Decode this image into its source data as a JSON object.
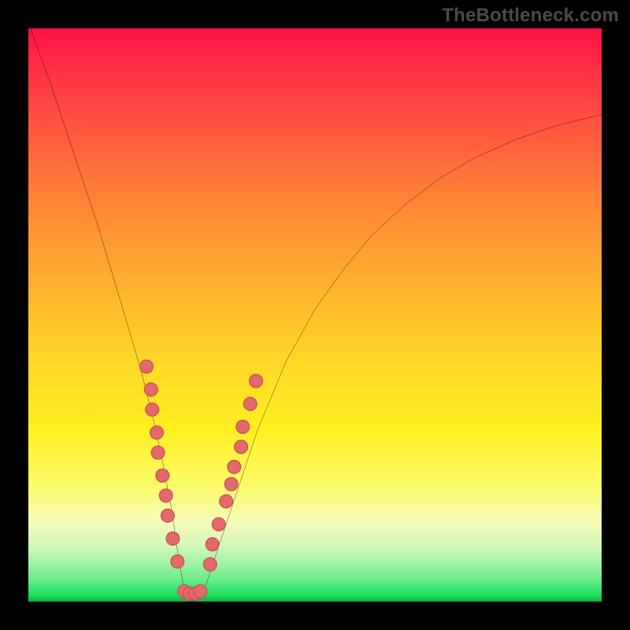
{
  "watermark": "TheBottleneck.com",
  "colors": {
    "frame": "#000000",
    "curve_stroke": "#000000",
    "marker_fill": "#e06a6c",
    "marker_stroke": "#d14e52",
    "gradient_top": "#ff1047",
    "gradient_bottom": "#11a83d"
  },
  "chart_data": {
    "type": "line",
    "title": "",
    "xlabel": "",
    "ylabel": "",
    "xlim": [
      0,
      100
    ],
    "ylim": [
      0,
      100
    ],
    "grid": false,
    "curve": {
      "x": [
        0,
        4,
        8,
        12,
        15,
        18,
        20,
        22,
        23.5,
        25,
        26,
        27,
        28,
        29,
        31,
        33,
        36,
        40,
        45,
        50,
        55,
        60,
        66,
        72,
        78,
        85,
        92,
        100
      ],
      "y": [
        101,
        90,
        78,
        66,
        56,
        46,
        39,
        31,
        24,
        16,
        9,
        3,
        0,
        0,
        3,
        9,
        18,
        30,
        42,
        51,
        58,
        64,
        69.5,
        74,
        77.5,
        80.6,
        83,
        85
      ]
    },
    "markers": [
      {
        "x": 20.6,
        "y": 41
      },
      {
        "x": 21.4,
        "y": 37
      },
      {
        "x": 21.6,
        "y": 33.5
      },
      {
        "x": 22.4,
        "y": 29.5
      },
      {
        "x": 22.6,
        "y": 26
      },
      {
        "x": 23.4,
        "y": 22
      },
      {
        "x": 24.0,
        "y": 18.5
      },
      {
        "x": 24.3,
        "y": 15
      },
      {
        "x": 25.2,
        "y": 11
      },
      {
        "x": 26.0,
        "y": 7
      },
      {
        "x": 27.2,
        "y": 1.8
      },
      {
        "x": 28.1,
        "y": 1.4
      },
      {
        "x": 29.1,
        "y": 1.4
      },
      {
        "x": 30.0,
        "y": 1.8
      },
      {
        "x": 31.7,
        "y": 6.5
      },
      {
        "x": 32.1,
        "y": 10
      },
      {
        "x": 33.2,
        "y": 13.5
      },
      {
        "x": 34.5,
        "y": 17.5
      },
      {
        "x": 35.4,
        "y": 20.5
      },
      {
        "x": 35.9,
        "y": 23.5
      },
      {
        "x": 37.1,
        "y": 27
      },
      {
        "x": 37.4,
        "y": 30.5
      },
      {
        "x": 38.7,
        "y": 34.5
      },
      {
        "x": 39.7,
        "y": 38.5
      }
    ]
  }
}
